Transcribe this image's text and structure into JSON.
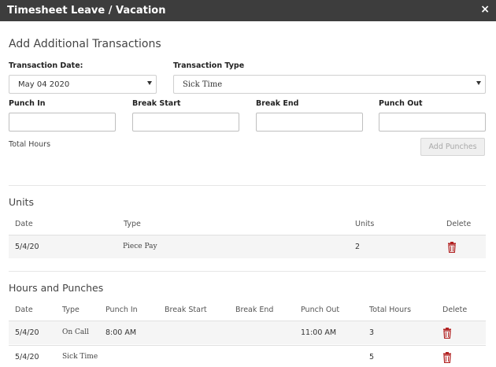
{
  "window": {
    "title": "Timesheet Leave / Vacation",
    "close_glyph": "×"
  },
  "add_section": {
    "heading": "Add Additional Transactions",
    "transaction_date": {
      "label": "Transaction Date:",
      "value": "May 04 2020"
    },
    "transaction_type": {
      "label": "Transaction Type",
      "value": "Sick Time"
    },
    "punch_in_label": "Punch In",
    "break_start_label": "Break Start",
    "break_end_label": "Break End",
    "punch_out_label": "Punch Out",
    "total_hours_label": "Total Hours",
    "add_punches_label": "Add Punches"
  },
  "units_section": {
    "heading": "Units",
    "columns": [
      "Date",
      "Type",
      "Units",
      "Delete"
    ],
    "rows": [
      {
        "date": "5/4/20",
        "type": "Piece Pay",
        "units": "2",
        "delete_icon": "trash-icon"
      }
    ]
  },
  "hours_section": {
    "heading": "Hours and Punches",
    "columns": [
      "Date",
      "Type",
      "Punch In",
      "Break Start",
      "Break End",
      "Punch Out",
      "Total Hours",
      "Delete"
    ],
    "rows": [
      {
        "date": "5/4/20",
        "type": "On Call",
        "punch_in": "8:00 AM",
        "break_start": "",
        "break_end": "",
        "punch_out": "11:00 AM",
        "total_hours": "3",
        "delete_icon": "trash-icon"
      },
      {
        "date": "5/4/20",
        "type": "Sick Time",
        "punch_in": "",
        "break_start": "",
        "break_end": "",
        "punch_out": "",
        "total_hours": "5",
        "delete_icon": "trash-icon"
      }
    ]
  },
  "colors": {
    "titlebar": "#3d3d3d",
    "delete_icon": "#b22222"
  }
}
